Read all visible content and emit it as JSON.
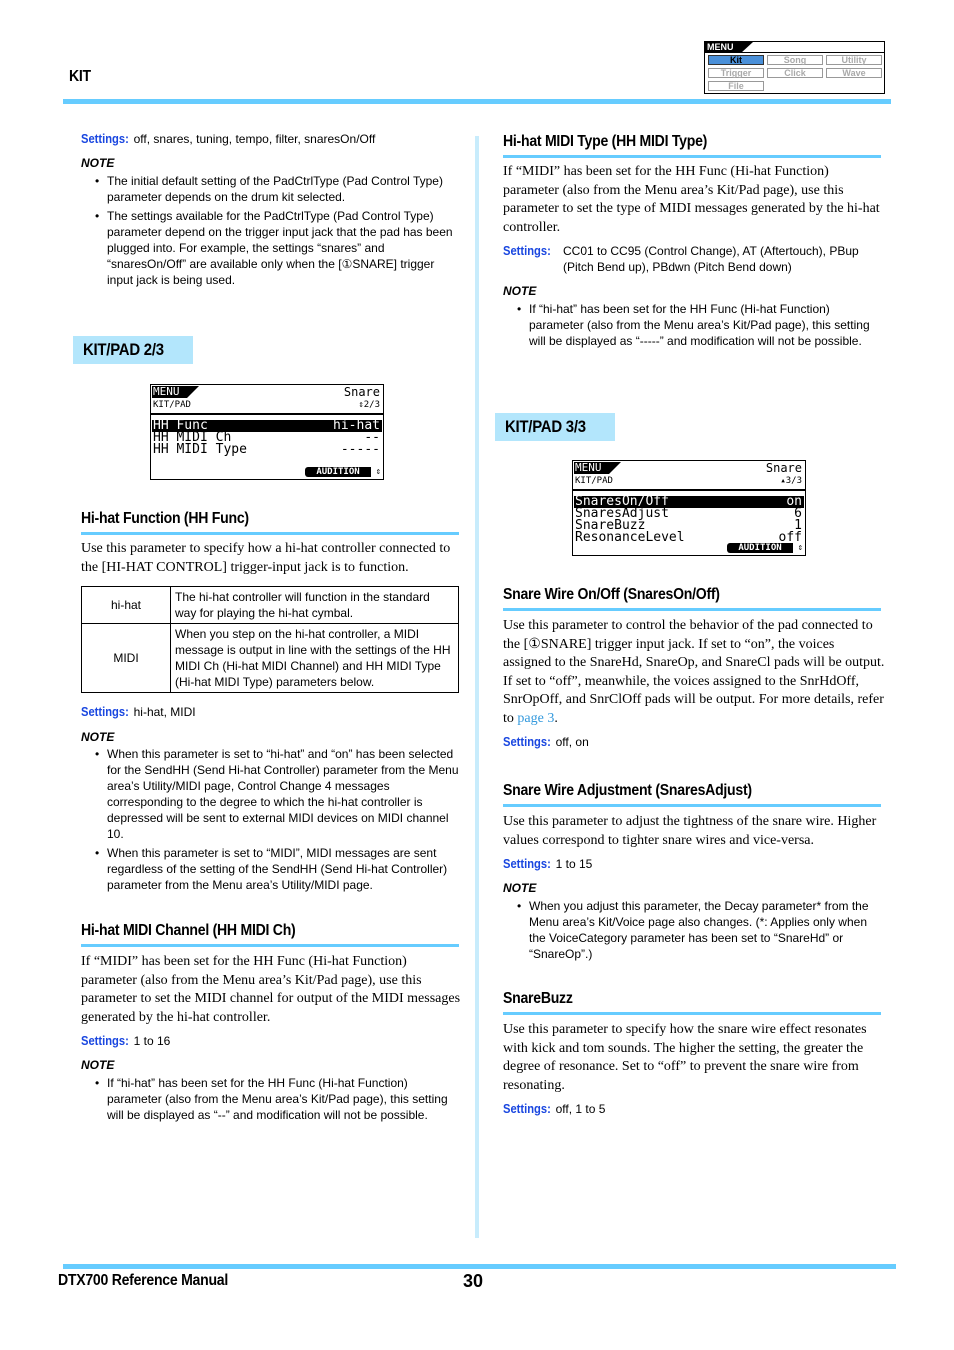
{
  "header": {
    "section": "KIT",
    "menu_nav": {
      "title": "MENU",
      "items": [
        {
          "label": "Kit",
          "active": true
        },
        {
          "label": "Song",
          "active": false
        },
        {
          "label": "Utility",
          "active": false
        },
        {
          "label": "Trigger",
          "active": false
        },
        {
          "label": "Click",
          "active": false
        },
        {
          "label": "Wave",
          "active": false
        },
        {
          "label": "File",
          "active": false
        }
      ]
    }
  },
  "left": {
    "intro_settings": {
      "label": "Settings:",
      "value": "off, snares, tuning, tempo, filter, snaresOn/Off"
    },
    "intro_note": {
      "label": "NOTE",
      "items": [
        "The initial default setting of the PadCtrlType (Pad Control Type) parameter depends on the drum kit selected.",
        "The settings available for the PadCtrlType (Pad Control Type) parameter depend on the trigger input jack that the pad has been plugged into. For example, the settings “snares” and “snaresOn/Off” are available only when the [①SNARE] trigger input jack is being used."
      ]
    },
    "page_badge": "KIT/PAD  2/3",
    "lcd": {
      "menu": "MENU",
      "name": "Snare",
      "page": "KIT/PAD",
      "page_num": "⇕2/3",
      "rows": [
        {
          "param": "HH Func",
          "value": "hi-hat",
          "selected": true
        },
        {
          "param": "HH MIDI Ch",
          "value": "--",
          "selected": false
        },
        {
          "param": "HH MIDI Type",
          "value": "-----",
          "selected": false
        }
      ],
      "audition": "AUDITION",
      "audition_arrow": "⇕"
    },
    "hh_func": {
      "heading": "Hi-hat Function (HH Func)",
      "body": "Use this parameter to specify how a hi-hat controller connected to the [HI-HAT CONTROL] trigger-input jack is to function.",
      "table": [
        {
          "key": "hi-hat",
          "desc": "The hi-hat controller will function in the standard way for playing the hi-hat cymbal."
        },
        {
          "key": "MIDI",
          "desc": "When you step on the hi-hat controller, a MIDI message is output in line with the settings of the HH MIDI Ch (Hi-hat MIDI Channel) and HH MIDI Type (Hi-hat MIDI Type) parameters below."
        }
      ],
      "settings": {
        "label": "Settings:",
        "value": "hi-hat, MIDI"
      },
      "note": {
        "label": "NOTE",
        "items": [
          "When this parameter is set to “hi-hat” and “on” has been selected for the SendHH (Send Hi-hat Controller) parameter from the Menu area’s Utility/MIDI page, Control Change 4 messages corresponding to the degree to which the hi-hat controller is depressed will be sent to external MIDI devices on MIDI channel 10.",
          "When this parameter is set to “MIDI”, MIDI messages are sent regardless of the setting of the SendHH (Send Hi-hat Controller) parameter from the Menu area’s Utility/MIDI page."
        ]
      }
    },
    "hh_midi_ch": {
      "heading": "Hi-hat MIDI Channel (HH MIDI Ch)",
      "body": "If “MIDI” has been set for the HH Func (Hi-hat Function) parameter (also from the Menu area’s Kit/Pad page), use this parameter to set the MIDI channel for output of the MIDI messages generated by the hi-hat controller.",
      "settings": {
        "label": "Settings:",
        "value": "1 to 16"
      },
      "note": {
        "label": "NOTE",
        "items": [
          "If “hi-hat” has been set for the HH Func (Hi-hat Function) parameter (also from the Menu area’s Kit/Pad page), this setting will be displayed as “--” and modification will not be possible."
        ]
      }
    }
  },
  "right": {
    "hh_midi_type": {
      "heading": "Hi-hat MIDI Type (HH MIDI Type)",
      "body": "If “MIDI” has been set for the HH Func (Hi-hat Function) parameter (also from the Menu area’s Kit/Pad page), use this parameter to set the type of MIDI messages generated by the hi-hat controller.",
      "settings": {
        "label": "Settings:",
        "value": "CC01 to CC95 (Control Change), AT (Aftertouch), PBup (Pitch Bend up), PBdwn (Pitch Bend down)"
      },
      "note": {
        "label": "NOTE",
        "items": [
          "If “hi-hat” has been set for the HH Func (Hi-hat Function) parameter (also from the Menu area’s Kit/Pad page), this setting will be displayed as “-----” and modification will not be possible."
        ]
      }
    },
    "page_badge": "KIT/PAD  3/3",
    "lcd": {
      "menu": "MENU",
      "name": "Snare",
      "page": "KIT/PAD",
      "page_num": "▴3/3",
      "rows": [
        {
          "param": "SnaresOn/Off",
          "value": "on",
          "selected": true
        },
        {
          "param": "SnaresAdjust",
          "value": "6",
          "selected": false
        },
        {
          "param": "SnareBuzz",
          "value": "1",
          "selected": false
        },
        {
          "param": "ResonanceLevel",
          "value": "off",
          "selected": false
        }
      ],
      "audition": "AUDITION",
      "audition_arrow": "⇕"
    },
    "snares_onoff": {
      "heading": "Snare Wire On/Off (SnaresOn/Off)",
      "body_pre": "Use this parameter to control the behavior of the pad connected to the [①SNARE] trigger input jack. If set to “on”, the voices assigned to the SnareHd, SnareOp, and SnareCl pads will be output. If set to “off”, meanwhile, the voices assigned to the SnrHdOff, SnrOpOff, and SnrClOff pads will be output. For more details, refer to ",
      "link": "page 3",
      "body_post": ".",
      "settings": {
        "label": "Settings:",
        "value": "off, on"
      }
    },
    "snares_adjust": {
      "heading": "Snare Wire Adjustment (SnaresAdjust)",
      "body": "Use this parameter to adjust the tightness of the snare wire. Higher values correspond to tighter snare wires and vice-versa.",
      "settings": {
        "label": "Settings:",
        "value": "1 to 15"
      },
      "note": {
        "label": "NOTE",
        "items": [
          "When you adjust this parameter, the Decay parameter* from the Menu area’s Kit/Voice page also changes. (*: Applies only when the VoiceCategory parameter has been set to “SnareHd” or “SnareOp”.)"
        ]
      }
    },
    "snare_buzz": {
      "heading": "SnareBuzz",
      "body": "Use this parameter to specify how the snare wire effect resonates with kick and tom sounds. The higher the setting, the greater the degree of resonance. Set to “off” to prevent the snare wire from resonating.",
      "settings": {
        "label": "Settings:",
        "value": "off, 1 to 5"
      }
    }
  },
  "footer": {
    "title": "DTX700  Reference Manual",
    "page_number": "30"
  },
  "colors": {
    "accent_rule": "#66ccff",
    "badge_bg": "#b3e6fc",
    "settings_label": "#1a47e0",
    "link": "#3399dd",
    "active_menu": "#4a90d9"
  }
}
